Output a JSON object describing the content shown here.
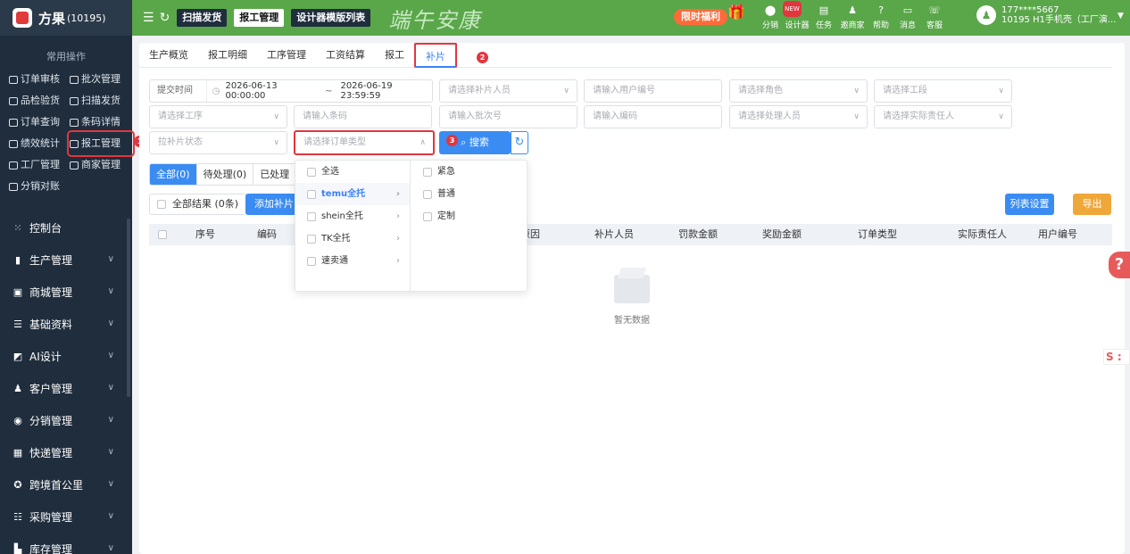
{
  "brand": {
    "name": "方果",
    "code": "(10195)"
  },
  "sidebar": {
    "common_title": "常用操作",
    "quick": [
      {
        "label": "订单审核"
      },
      {
        "label": "批次管理"
      },
      {
        "label": "品检验货"
      },
      {
        "label": "扫描发货"
      },
      {
        "label": "订单查询"
      },
      {
        "label": "条码详情"
      },
      {
        "label": "绩效统计"
      },
      {
        "label": "报工管理"
      },
      {
        "label": "工厂管理"
      },
      {
        "label": "商家管理"
      },
      {
        "label": "分销对账"
      }
    ],
    "menu": [
      {
        "label": "控制台",
        "icon": "dashboard-icon"
      },
      {
        "label": "生产管理",
        "icon": "production-icon"
      },
      {
        "label": "商城管理",
        "icon": "mall-icon"
      },
      {
        "label": "基础资料",
        "icon": "data-icon"
      },
      {
        "label": "AI设计",
        "icon": "ai-icon"
      },
      {
        "label": "客户管理",
        "icon": "customer-icon"
      },
      {
        "label": "分销管理",
        "icon": "distribution-icon"
      },
      {
        "label": "快递管理",
        "icon": "express-icon"
      },
      {
        "label": "跨境首公里",
        "icon": "crossborder-icon"
      },
      {
        "label": "采购管理",
        "icon": "purchase-icon"
      },
      {
        "label": "库存管理",
        "icon": "inventory-icon"
      }
    ]
  },
  "header": {
    "buttons": [
      "扫描发货",
      "报工管理",
      "设计器模版列表"
    ],
    "festival": "端午安康",
    "promo": "限时福利",
    "icons": [
      {
        "label": "分销",
        "icon": "distribution-icon",
        "new": "NEW"
      },
      {
        "label": "设计器",
        "icon": "designer-icon"
      },
      {
        "label": "任务",
        "icon": "task-icon"
      },
      {
        "label": "邀商家",
        "icon": "invite-icon"
      },
      {
        "label": "帮助",
        "icon": "help-icon"
      },
      {
        "label": "消息",
        "icon": "message-icon"
      },
      {
        "label": "客服",
        "icon": "service-icon"
      }
    ],
    "user_phone": "177****5667",
    "user_shop": "10195 H1手机壳（工厂演..."
  },
  "tabs": [
    "生产概览",
    "报工明细",
    "工序管理",
    "工资结算",
    "报工",
    "补片"
  ],
  "annotations": {
    "a1": "1",
    "a2": "2",
    "a3": "3"
  },
  "filters": {
    "date_prefix": "提交时间",
    "date_start": "2026-06-13 00:00:00",
    "date_sep": "~",
    "date_end": "2026-06-19 23:59:59",
    "patch_staff": "请选择补片人员",
    "user_no": "请输入用户编号",
    "role": "请选择角色",
    "section": "请选择工段",
    "process": "请选择工序",
    "barcode": "请输入条码",
    "batch": "请输入批次号",
    "code": "请输入编码",
    "handler": "请选择处理人员",
    "responsible": "请选择实际责任人",
    "patch_status": "拉补片状态",
    "order_type": "请选择订单类型",
    "search": "搜索"
  },
  "status_tabs": [
    "全部(0)",
    "待处理(0)",
    "已处理"
  ],
  "actions": {
    "select_all": "全部结果 (0条)",
    "add": "添加补片",
    "columns": "列表设置",
    "export": "导出"
  },
  "table_headers": [
    "序号",
    "编码",
    "原因",
    "补片人员",
    "罚款金额",
    "奖励金额",
    "订单类型",
    "实际责任人",
    "用户编号"
  ],
  "empty_text": "暂无数据",
  "dropdown": {
    "left": [
      {
        "label": "全选",
        "arrow": false
      },
      {
        "label": "temu全托",
        "arrow": true
      },
      {
        "label": "shein全托",
        "arrow": true
      },
      {
        "label": "TK全托",
        "arrow": true
      },
      {
        "label": "速卖通",
        "arrow": true
      }
    ],
    "right": [
      "紧急",
      "普通",
      "定制"
    ]
  }
}
